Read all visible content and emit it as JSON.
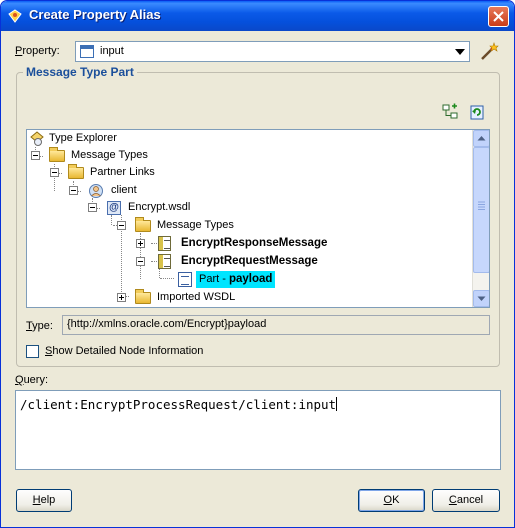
{
  "window": {
    "title": "Create Property Alias"
  },
  "property": {
    "label_mnemonic": "P",
    "label_rest": "roperty:",
    "value": "input"
  },
  "message_type_part": {
    "legend": "Message Type Part",
    "tree": {
      "root": "Type Explorer",
      "message_types": "Message Types",
      "partner_links": "Partner Links",
      "client": "client",
      "wsdl": "Encrypt.wsdl",
      "wsdl_message_types": "Message Types",
      "response_message": "EncryptResponseMessage",
      "request_message": "EncryptRequestMessage",
      "part_prefix": "Part - ",
      "part_name": "payload",
      "imported": "Imported WSDL"
    },
    "type_label_mnemonic": "T",
    "type_label_rest": "ype:",
    "type_value": "{http://xmlns.oracle.com/Encrypt}payload",
    "checkbox_mnemonic": "S",
    "checkbox_rest": "how Detailed Node Information"
  },
  "query": {
    "label_mnemonic": "Q",
    "label_rest": "uery:",
    "value": "/client:EncryptProcessRequest/client:input"
  },
  "buttons": {
    "help_mnemonic": "H",
    "help_rest": "elp",
    "ok_mnemonic": "O",
    "ok_rest": "K",
    "cancel_mnemonic": "C",
    "cancel_rest": "ancel"
  }
}
